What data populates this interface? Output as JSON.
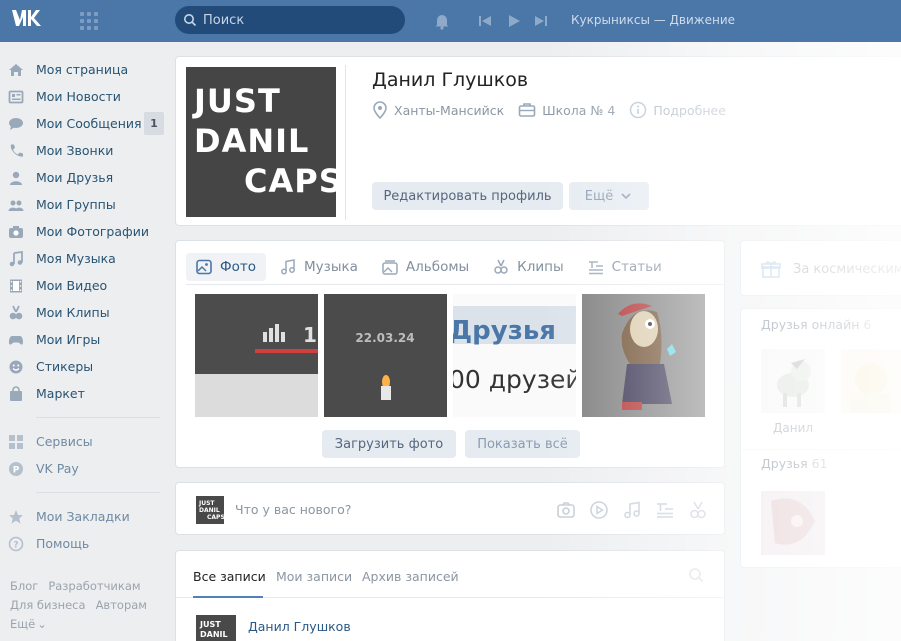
{
  "header": {
    "search_placeholder": "Поиск",
    "now_playing": "Кукрыниксы — Движение",
    "colors": {
      "bar": "#4a76a8",
      "search_bg": "#224b7a"
    }
  },
  "leftnav": {
    "items": [
      {
        "label": "Моя страница",
        "icon": "home-icon"
      },
      {
        "label": "Мои Новости",
        "icon": "news-icon"
      },
      {
        "label": "Мои Сообщения",
        "icon": "messages-icon",
        "badge": "1"
      },
      {
        "label": "Мои Звонки",
        "icon": "phone-icon"
      },
      {
        "label": "Мои Друзья",
        "icon": "user-icon"
      },
      {
        "label": "Мои Группы",
        "icon": "group-icon"
      },
      {
        "label": "Мои Фотографии",
        "icon": "camera-icon"
      },
      {
        "label": "Моя Музыка",
        "icon": "music-icon"
      },
      {
        "label": "Мои Видео",
        "icon": "video-icon"
      },
      {
        "label": "Мои Клипы",
        "icon": "clips-icon"
      },
      {
        "label": "Мои Игры",
        "icon": "gamepad-icon"
      },
      {
        "label": "Стикеры",
        "icon": "smile-icon"
      },
      {
        "label": "Маркет",
        "icon": "bag-icon"
      }
    ],
    "services": [
      {
        "label": "Сервисы",
        "icon": "apps-icon"
      },
      {
        "label": "VK Pay",
        "icon": "vkpay-icon"
      }
    ],
    "extra": [
      {
        "label": "Мои Закладки",
        "icon": "star-icon"
      },
      {
        "label": "Помощь",
        "icon": "help-icon"
      }
    ],
    "footer": [
      "Блог",
      "Разработчикам",
      "Для бизнеса",
      "Авторам",
      "Ещё"
    ]
  },
  "profile": {
    "avatar_text": [
      "JUST",
      "DANIL",
      "CAPS"
    ],
    "name": "Данил Глушков",
    "city": "Ханты-Мансийск",
    "school": "Школа № 4",
    "details": "Подробнее",
    "edit_label": "Редактировать профиль",
    "more_label": "Ещё"
  },
  "media": {
    "tabs": [
      {
        "label": "Фото",
        "icon": "photo-icon"
      },
      {
        "label": "Музыка",
        "icon": "music-icon"
      },
      {
        "label": "Альбомы",
        "icon": "albums-icon"
      },
      {
        "label": "Клипы",
        "icon": "clips-icon"
      },
      {
        "label": "Статьи",
        "icon": "articles-icon"
      }
    ],
    "photo_texts": {
      "date": "22.03.24",
      "friends_word": "Друзья",
      "friends_count": "00 друзей",
      "counter": "1("
    },
    "upload_label": "Загрузить фото",
    "showall_label": "Показать всё"
  },
  "postbox": {
    "placeholder": "Что у вас нового?",
    "avatar_text": [
      "JUST",
      "DANIL",
      "CAPS"
    ]
  },
  "wall": {
    "tabs": [
      "Все записи",
      "Мои записи",
      "Архив записей"
    ],
    "author": "Данил Глушков"
  },
  "right": {
    "gift_label": "За космическими",
    "friends_online_label": "Друзья онлайн",
    "friends_online_count": "6",
    "friends_label": "Друзья",
    "friends_count": "61",
    "friend_name": "Данил"
  }
}
